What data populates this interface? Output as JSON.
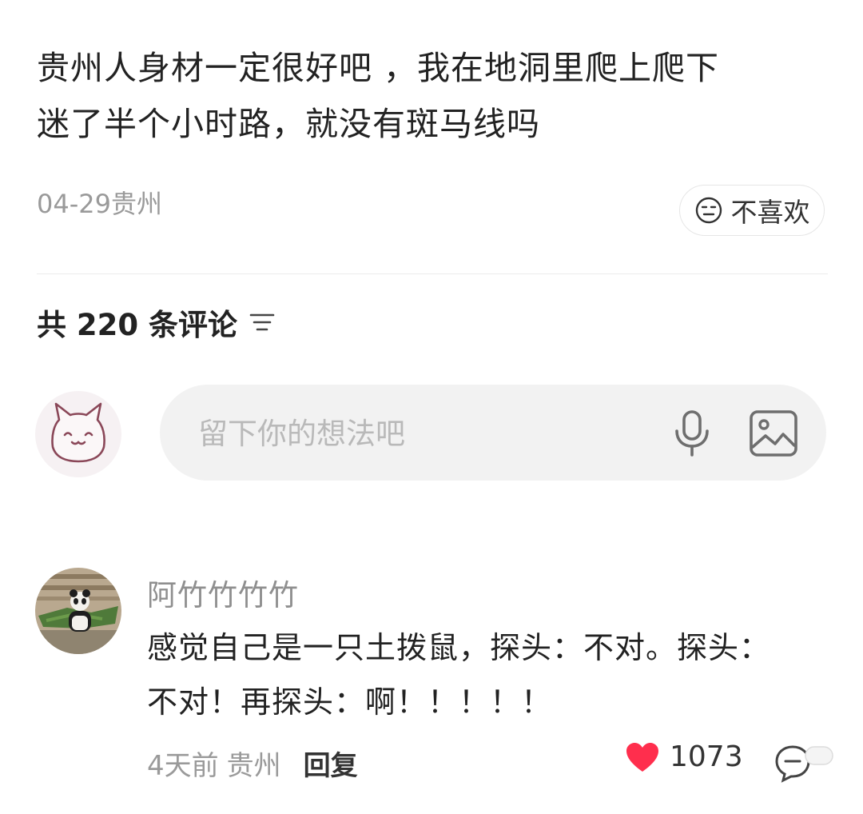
{
  "post": {
    "text_line1": "贵州人身材一定很好吧 ，我在地洞里爬上爬下",
    "text_line2": "迷了半个小时路，就没有斑马线吗",
    "date": "04-29",
    "location": "贵州",
    "dislike_label": "不喜欢",
    "dislike_icon": "neutral-face-icon"
  },
  "comments_header": {
    "count_label": "共 220 条评论",
    "sort_icon": "filter-lines-icon"
  },
  "composer": {
    "placeholder": "留下你的想法吧",
    "mic_icon": "microphone-icon",
    "image_icon": "image-icon"
  },
  "comment": {
    "username": "阿竹竹竹竹",
    "text_line1": "感觉自己是一只土拨鼠，探头：不对。探头：",
    "text_line2": "不对！再探头：啊！！！！！",
    "time": "4天前",
    "location": "贵州",
    "reply_label": "回复",
    "like_count": "1073",
    "liked": true,
    "like_color": "#ff2e4d"
  }
}
